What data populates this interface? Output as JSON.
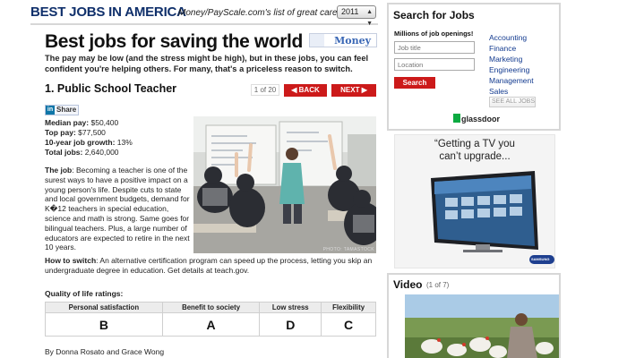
{
  "header": {
    "section_title": "BEST JOBS IN AMERICA",
    "subtitle": "Money/PayScale.com's list of great careers",
    "year": "2011"
  },
  "article": {
    "title": "Best jobs for saving the world",
    "brand": "Money",
    "intro": "The pay may be low (and the stress might be high), but in these jobs, you can feel confident you're helping others. For many, that's a priceless reason to switch.",
    "job_title": "1. Public School Teacher",
    "pager": {
      "count": "1 of 20",
      "back": "BACK",
      "next": "NEXT"
    },
    "share_label": "Share",
    "share_icon": "in",
    "stats": [
      {
        "label": "Median pay:",
        "value": "$50,400"
      },
      {
        "label": "Top pay:",
        "value": "$77,500"
      },
      {
        "label": "10-year job growth:",
        "value": "13%"
      },
      {
        "label": "Total jobs:",
        "value": "2,640,000"
      }
    ],
    "photo_credit": "PHOTO: TAMASTOCK",
    "job_label": "The job",
    "job_text": ": Becoming a teacher is one of the surest ways to have a positive impact on a young person's life. Despite cuts to state and local government budgets, demand for K�12 teachers in special education, science and math is strong. Same goes for bilingual teachers. Plus, a large number of educators are expected to retire in the next 10 years.",
    "howto_label": "How to switch",
    "howto_text": ": An alternative certification program can speed up the process, letting you skip an undergraduate degree in education. Get details at teach.gov.",
    "qol_title": "Quality of life ratings:",
    "ratings": {
      "headers": [
        "Personal satisfaction",
        "Benefit to society",
        "Low stress",
        "Flexibility"
      ],
      "grades": [
        "B",
        "A",
        "D",
        "C"
      ]
    },
    "byline": "By Donna Rosato and Grace Wong"
  },
  "jobs_search": {
    "title": "Search for Jobs",
    "subtitle": "Millions of job openings!",
    "job_placeholder": "Job title",
    "location_placeholder": "Location",
    "search_label": "Search",
    "categories": [
      "Accounting",
      "Finance",
      "Marketing",
      "Engineering",
      "Management",
      "Sales"
    ],
    "see_all": "SEE ALL JOBS",
    "powered_by": "glassdoor"
  },
  "ad": {
    "text_line1": "“Getting a TV you",
    "text_line2": "can’t upgrade...",
    "brand": "SAMSUNG"
  },
  "video": {
    "title": "Video",
    "count": "(1 of 7)"
  },
  "colors": {
    "brand_navy": "#10306b",
    "nav_red": "#cc1a1a",
    "link_blue": "#123a8f",
    "glassdoor_green": "#0caa41"
  }
}
